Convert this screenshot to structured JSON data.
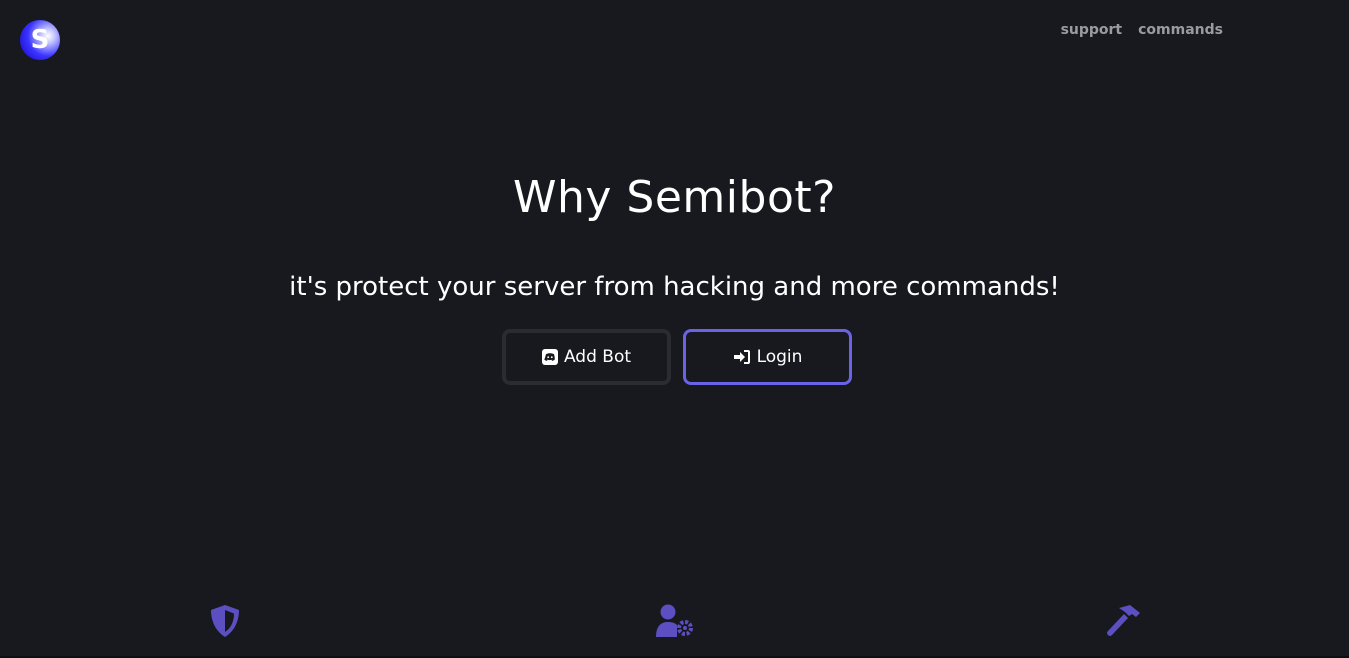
{
  "header": {
    "logo_letter": "S",
    "nav": [
      {
        "label": "support"
      },
      {
        "label": "commands"
      }
    ]
  },
  "hero": {
    "title": "Why Semibot?",
    "subtitle": "it's protect your server from hacking and more commands!",
    "buttons": {
      "add_bot": {
        "label": "Add Bot",
        "icon": "discord-icon"
      },
      "login": {
        "label": "Login",
        "icon": "sign-in-icon"
      }
    }
  },
  "features": {
    "icons": [
      "shield-icon",
      "user-gear-icon",
      "hammer-icon"
    ],
    "accent_color": "#5b4fc2"
  },
  "colors": {
    "background": "#18191f",
    "login_border": "#6a63e8",
    "add_bot_border": "#2b2c32",
    "nav_text": "#9a9aa0"
  }
}
